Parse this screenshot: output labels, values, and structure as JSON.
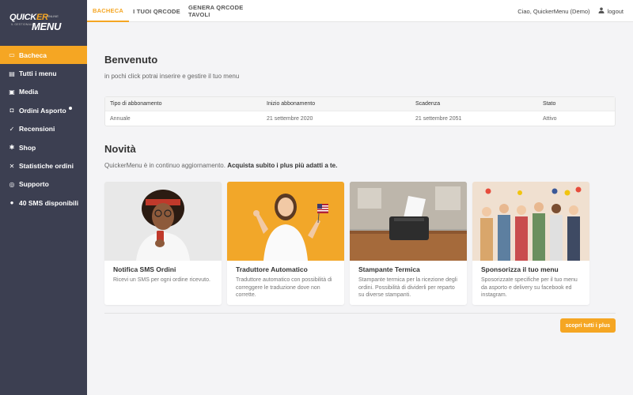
{
  "brand": {
    "logo_top": "QUICK",
    "logo_er": "ER",
    "logo_bottom": "MENU",
    "logo_online": "ONLINE",
    "logo_sub": "IL GESTIONALE",
    "accent": "#f5a623",
    "sidebar_bg": "#3c3f51"
  },
  "sidebar": {
    "items": [
      {
        "label": "Bacheca",
        "icon": "wallet-icon",
        "glyph": "▭"
      },
      {
        "label": "Tutti i menu",
        "icon": "book-icon",
        "glyph": "▤"
      },
      {
        "label": "Media",
        "icon": "image-icon",
        "glyph": "▣"
      },
      {
        "label": "Ordini Asporto",
        "icon": "bag-icon",
        "glyph": "◘"
      },
      {
        "label": "Recensioni",
        "icon": "check-circle-icon",
        "glyph": "✓"
      },
      {
        "label": "Shop",
        "icon": "gear-icon",
        "glyph": "✱"
      },
      {
        "label": "Statistiche ordini",
        "icon": "tools-icon",
        "glyph": "✕"
      },
      {
        "label": "Supporto",
        "icon": "support-icon",
        "glyph": "◎"
      },
      {
        "label": "40 SMS disponibili",
        "icon": "chat-icon",
        "glyph": "●"
      }
    ]
  },
  "topbar": {
    "tabs": [
      "BACHECA",
      "I TUOI QRCODE",
      "GENERA QRCODE TAVOLI"
    ],
    "greeting": "Ciao, QuickerMenu (Demo)",
    "logout": "logout"
  },
  "welcome": {
    "title": "Benvenuto",
    "subtitle": "in pochi click potrai inserire e gestire il tuo menu"
  },
  "subscription": {
    "headers": [
      "Tipo di abbonamento",
      "Inizio abbonamento",
      "Scadenza",
      "Stato"
    ],
    "values": [
      "Annuale",
      "21 settembre 2020",
      "21 settembre 2051",
      "Attivo"
    ]
  },
  "news": {
    "title": "Novità",
    "intro_plain": "QuickerMenu è in continuo aggiornamento. ",
    "intro_bold": "Acquista subito i plus più adatti a te.",
    "cards": [
      {
        "title": "Notifica SMS Ordini",
        "desc": "Ricevi un SMS per ogni ordine ricevuto."
      },
      {
        "title": "Traduttore Automatico",
        "desc": "Traduttore automatico con possibilità di correggere le traduzione dove non corrette."
      },
      {
        "title": "Stampante Termica",
        "desc": "Stampante termica per la ricezione degli ordini. Possibilità di dividerli per reparto su diverse stampanti."
      },
      {
        "title": "Sponsorizza il tuo menu",
        "desc": "Sposorizzate specifiche per il tuo menu da asporto e delivery su facebook ed instagram."
      }
    ],
    "button": "scopri tutti i plus"
  }
}
